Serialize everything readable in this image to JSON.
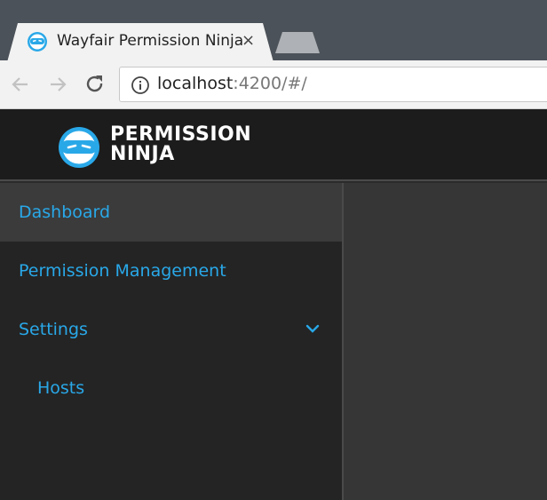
{
  "browser": {
    "tab_title": "Wayfair Permission Ninja",
    "tab_close_label": "×",
    "url_host": "localhost",
    "url_rest": ":4200/#/"
  },
  "header": {
    "logo_line1": "PERMISSION",
    "logo_line2": "NINJA"
  },
  "sidebar": {
    "items": [
      {
        "label": "Dashboard",
        "active": true
      },
      {
        "label": "Permission Management"
      },
      {
        "label": "Settings",
        "expanded": true
      },
      {
        "label": "Hosts",
        "sub": true
      }
    ]
  },
  "colors": {
    "accent": "#29a8e8",
    "header_bg": "#1c1c1c",
    "sidebar_bg": "#242424",
    "content_bg": "#363636"
  },
  "icons": [
    "ninja-favicon-icon",
    "back-arrow-icon",
    "forward-arrow-icon",
    "reload-icon",
    "info-icon",
    "ninja-logo-icon",
    "chevron-down-icon"
  ]
}
